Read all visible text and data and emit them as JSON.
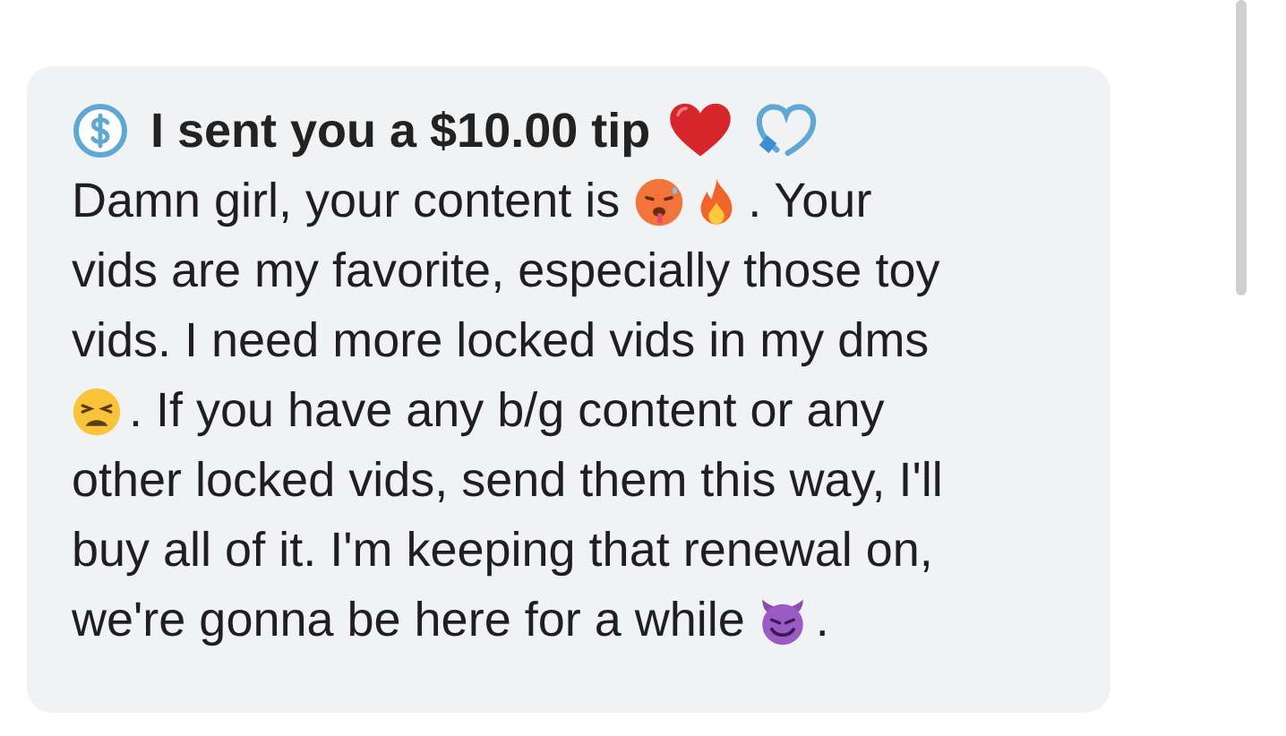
{
  "message": {
    "tip_header": {
      "text": "I sent you a $10.00 tip",
      "icons": [
        {
          "kind": "red_heart"
        },
        {
          "kind": "outline_heart"
        }
      ]
    },
    "lines": [
      [
        {
          "kind": "text",
          "text": "Damn girl, your content is "
        },
        {
          "kind": "hot_face"
        },
        {
          "kind": "fire"
        },
        {
          "kind": "text",
          "text": ". Your"
        }
      ],
      [
        {
          "kind": "text",
          "text": "vids are my favorite, especially those toy"
        }
      ],
      [
        {
          "kind": "text",
          "text": "vids. I need more locked vids in my dms"
        }
      ],
      [
        {
          "kind": "weary_face"
        },
        {
          "kind": "text",
          "text": ". If you have any b/g content or any"
        }
      ],
      [
        {
          "kind": "text",
          "text": "other locked vids, send them this way, I'll"
        }
      ],
      [
        {
          "kind": "text",
          "text": "buy all of it. I'm keeping that renewal on,"
        }
      ],
      [
        {
          "kind": "text",
          "text": "we're gonna be here for a while "
        },
        {
          "kind": "devil_face"
        },
        {
          "kind": "text",
          "text": "."
        }
      ]
    ]
  }
}
